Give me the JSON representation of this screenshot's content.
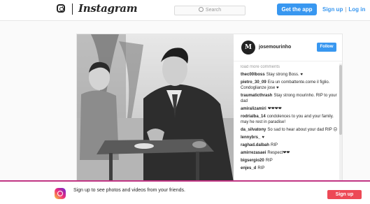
{
  "nav": {
    "logo_icon": "instagram-camera-icon",
    "wordmark": "Instagram",
    "search_placeholder": "Search",
    "get_app": "Get the app",
    "sign_up": "Sign up",
    "separator": "|",
    "log_in": "Log in"
  },
  "post": {
    "avatar_letter": "M",
    "username": "josemourinho",
    "follow": "Follow",
    "load_more": "load more comments",
    "comments": [
      {
        "user": "thec00lboss",
        "text": "Stay strong Boss. ♥"
      },
      {
        "user": "pietro_30_09",
        "text": "Era un combattente.come il figlio. Condoglianze jose ♥"
      },
      {
        "user": "traumaticthrash",
        "text": "Stay strong mourinho. RIP to your dad"
      },
      {
        "user": "amiralizamiri",
        "text": "❤❤❤❤"
      },
      {
        "user": "rodrialba_14",
        "text": "condolences to you and your family. may he rest in paradise!"
      },
      {
        "user": "da_silvatony",
        "text": "So sad to hear about your dad RIP ☹"
      },
      {
        "user": "lennybrs_",
        "text": "♥"
      },
      {
        "user": "raghad.dalbah",
        "text": "RIP"
      },
      {
        "user": "amirrezasaei",
        "text": "Respect❤❤"
      },
      {
        "user": "bigsergio20",
        "text": "RIP"
      },
      {
        "user": "enjes_d",
        "text": "RIP"
      }
    ]
  },
  "banner": {
    "text": "Sign up to see photos and videos from your friends.",
    "sign_up": "Sign up"
  },
  "colors": {
    "accent": "#3897f0",
    "signup_red": "#ed4956"
  }
}
